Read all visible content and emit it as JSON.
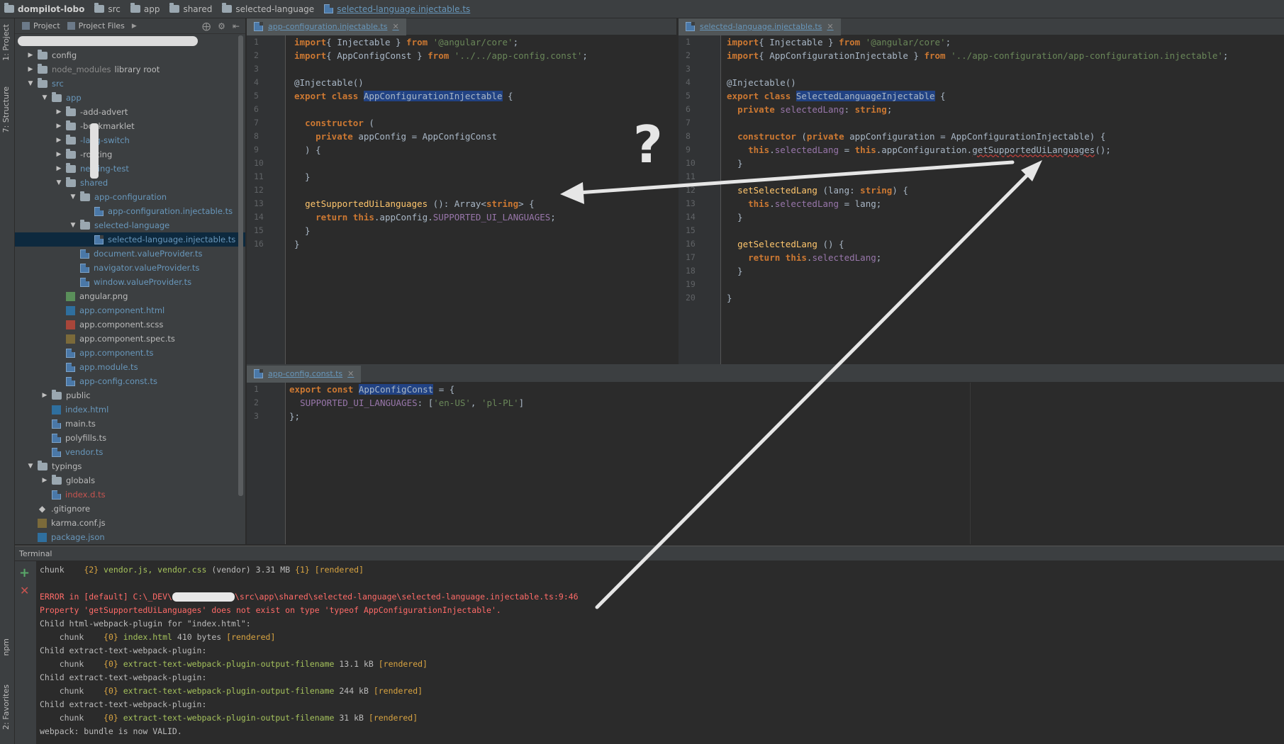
{
  "breadcrumb": [
    "dompilot-lobo",
    "src",
    "app",
    "shared",
    "selected-language",
    "selected-language.injectable.ts"
  ],
  "left_strip": {
    "project_tab": "1: Project",
    "structure_tab": "7: Structure",
    "npm_tab": "npm",
    "favorites_tab": "2: Favorites"
  },
  "project_panel": {
    "tabs": [
      "Project",
      "Project Files"
    ],
    "tree": [
      {
        "label": "config",
        "depth": 1,
        "kind": "folder",
        "arrow": "right"
      },
      {
        "label": "node_modules",
        "extra": "library root",
        "depth": 1,
        "kind": "folder",
        "arrow": "right",
        "style": "dim"
      },
      {
        "label": "src",
        "depth": 1,
        "kind": "folder",
        "arrow": "down",
        "style": "blue"
      },
      {
        "label": "app",
        "depth": 2,
        "kind": "folder",
        "arrow": "down",
        "style": "blue"
      },
      {
        "label": "-add-advert",
        "depth": 3,
        "kind": "folder",
        "arrow": "right"
      },
      {
        "label": "-bookmarklet",
        "depth": 3,
        "kind": "folder",
        "arrow": "right"
      },
      {
        "label": "-lang-switch",
        "depth": 3,
        "kind": "folder",
        "arrow": "right",
        "style": "blue"
      },
      {
        "label": "-routing",
        "depth": 3,
        "kind": "folder",
        "arrow": "right"
      },
      {
        "label": "nesting-test",
        "depth": 3,
        "kind": "folder",
        "arrow": "right",
        "style": "blue"
      },
      {
        "label": "shared",
        "depth": 3,
        "kind": "folder",
        "arrow": "down",
        "style": "blue"
      },
      {
        "label": "app-configuration",
        "depth": 4,
        "kind": "folder",
        "arrow": "down",
        "style": "blue"
      },
      {
        "label": "app-configuration.injectable.ts",
        "depth": 5,
        "kind": "ts",
        "style": "blue"
      },
      {
        "label": "selected-language",
        "depth": 4,
        "kind": "folder",
        "arrow": "down",
        "style": "blue"
      },
      {
        "label": "selected-language.injectable.ts",
        "depth": 5,
        "kind": "ts",
        "style": "blue",
        "selected": true
      },
      {
        "label": "document.valueProvider.ts",
        "depth": 4,
        "kind": "ts",
        "style": "blue"
      },
      {
        "label": "navigator.valueProvider.ts",
        "depth": 4,
        "kind": "ts",
        "style": "blue"
      },
      {
        "label": "window.valueProvider.ts",
        "depth": 4,
        "kind": "ts",
        "style": "blue"
      },
      {
        "label": "angular.png",
        "depth": 3,
        "kind": "img"
      },
      {
        "label": "app.component.html",
        "depth": 3,
        "kind": "html",
        "style": "blue"
      },
      {
        "label": "app.component.scss",
        "depth": 3,
        "kind": "scss"
      },
      {
        "label": "app.component.spec.ts",
        "depth": 3,
        "kind": "spec"
      },
      {
        "label": "app.component.ts",
        "depth": 3,
        "kind": "ts",
        "style": "blue"
      },
      {
        "label": "app.module.ts",
        "depth": 3,
        "kind": "ts",
        "style": "blue"
      },
      {
        "label": "app-config.const.ts",
        "depth": 3,
        "kind": "ts",
        "style": "blue"
      },
      {
        "label": "public",
        "depth": 2,
        "kind": "folder",
        "arrow": "right"
      },
      {
        "label": "index.html",
        "depth": 2,
        "kind": "html",
        "style": "blue"
      },
      {
        "label": "main.ts",
        "depth": 2,
        "kind": "ts"
      },
      {
        "label": "polyfills.ts",
        "depth": 2,
        "kind": "ts"
      },
      {
        "label": "vendor.ts",
        "depth": 2,
        "kind": "ts",
        "style": "blue"
      },
      {
        "label": "typings",
        "depth": 1,
        "kind": "folder",
        "arrow": "down"
      },
      {
        "label": "globals",
        "depth": 2,
        "kind": "folder",
        "arrow": "right"
      },
      {
        "label": "index.d.ts",
        "depth": 2,
        "kind": "ts",
        "style": "red"
      },
      {
        "label": ".gitignore",
        "depth": 1,
        "kind": "git"
      },
      {
        "label": "karma.conf.js",
        "depth": 1,
        "kind": "js"
      },
      {
        "label": "package.json",
        "depth": 1,
        "kind": "json",
        "style": "blue"
      }
    ]
  },
  "editor_left": {
    "tab": "app-configuration.injectable.ts",
    "line_numbers": [
      "1",
      "2",
      "3",
      "4",
      "5",
      "6",
      "7",
      "8",
      "9",
      "10",
      "11",
      "12",
      "13",
      "14",
      "15",
      "16"
    ],
    "lines": [
      [
        [
          "kw",
          "import"
        ],
        [
          "",
          "{ Injectable } "
        ],
        [
          "kw",
          "from"
        ],
        [
          "str",
          " '@angular/core'"
        ],
        [
          "",
          ";"
        ]
      ],
      [
        [
          "kw",
          "import"
        ],
        [
          "",
          "{ AppConfigConst } "
        ],
        [
          "kw",
          "from"
        ],
        [
          "str",
          " '../../app-config.const'"
        ],
        [
          "",
          ";"
        ]
      ],
      [],
      [
        [
          "",
          "@Injectable()"
        ]
      ],
      [
        [
          "kw",
          "export class "
        ],
        [
          "hl",
          "AppConfigurationInjectable"
        ],
        [
          "",
          " {"
        ]
      ],
      [],
      [
        [
          "",
          "  "
        ],
        [
          "kw",
          "constructor"
        ],
        [
          "",
          " ("
        ]
      ],
      [
        [
          "",
          "    "
        ],
        [
          "kw",
          "private "
        ],
        [
          "",
          "appConfig = AppConfigConst"
        ]
      ],
      [
        [
          "",
          "  ) {"
        ]
      ],
      [],
      [
        [
          "",
          "  }"
        ]
      ],
      [],
      [
        [
          "",
          "  "
        ],
        [
          "fn",
          "getSupportedUiLanguages"
        ],
        [
          "",
          " (): Array<"
        ],
        [
          "kw",
          "string"
        ],
        [
          "",
          "> {"
        ]
      ],
      [
        [
          "",
          "    "
        ],
        [
          "kw",
          "return this"
        ],
        [
          "",
          ".appConfig."
        ],
        [
          "fld",
          "SUPPORTED_UI_LANGUAGES"
        ],
        [
          "",
          ";"
        ]
      ],
      [
        [
          "",
          "  }"
        ]
      ],
      [
        [
          "",
          "}"
        ]
      ]
    ]
  },
  "editor_right": {
    "tab": "selected-language.injectable.ts",
    "line_numbers": [
      "1",
      "2",
      "3",
      "4",
      "5",
      "6",
      "7",
      "8",
      "9",
      "10",
      "11",
      "12",
      "13",
      "14",
      "15",
      "16",
      "17",
      "18",
      "19",
      "20"
    ],
    "lines": [
      [
        [
          "kw",
          "import"
        ],
        [
          "",
          "{ Injectable } "
        ],
        [
          "kw",
          "from"
        ],
        [
          "str",
          " '@angular/core'"
        ],
        [
          "",
          ";"
        ]
      ],
      [
        [
          "kw",
          "import"
        ],
        [
          "",
          "{ AppConfigurationInjectable } "
        ],
        [
          "kw",
          "from"
        ],
        [
          "str",
          " '../app-configuration/app-configuration.injectable'"
        ],
        [
          "",
          ";"
        ]
      ],
      [],
      [
        [
          "",
          "@Injectable()"
        ]
      ],
      [
        [
          "kw",
          "export class "
        ],
        [
          "hl",
          "SelectedLanguageInjectable"
        ],
        [
          "",
          " {"
        ]
      ],
      [
        [
          "",
          "  "
        ],
        [
          "kw",
          "private "
        ],
        [
          "fld",
          "selectedLang"
        ],
        [
          "",
          ": "
        ],
        [
          "kw",
          "string"
        ],
        [
          "",
          ";"
        ]
      ],
      [],
      [
        [
          "",
          "  "
        ],
        [
          "kw",
          "constructor"
        ],
        [
          "",
          " ("
        ],
        [
          "kw",
          "private "
        ],
        [
          "",
          "appConfiguration = AppConfigurationInjectable) {"
        ]
      ],
      [
        [
          "",
          "    "
        ],
        [
          "kw",
          "this"
        ],
        [
          "",
          "."
        ],
        [
          "fld",
          "selectedLang"
        ],
        [
          "",
          " = "
        ],
        [
          "kw",
          "this"
        ],
        [
          "",
          ".appConfiguration."
        ],
        [
          "wavy",
          "getSupportedUiLanguages"
        ],
        [
          "",
          "();"
        ]
      ],
      [
        [
          "",
          "  }"
        ]
      ],
      [],
      [
        [
          "",
          "  "
        ],
        [
          "fn",
          "setSelectedLang"
        ],
        [
          "",
          " (lang: "
        ],
        [
          "kw",
          "string"
        ],
        [
          "",
          ") {"
        ]
      ],
      [
        [
          "",
          "    "
        ],
        [
          "kw",
          "this"
        ],
        [
          "",
          "."
        ],
        [
          "fld",
          "selectedLang"
        ],
        [
          "",
          " = lang;"
        ]
      ],
      [
        [
          "",
          "  }"
        ]
      ],
      [],
      [
        [
          "",
          "  "
        ],
        [
          "fn",
          "getSelectedLang"
        ],
        [
          "",
          " () {"
        ]
      ],
      [
        [
          "",
          "    "
        ],
        [
          "kw",
          "return this"
        ],
        [
          "",
          "."
        ],
        [
          "fld",
          "selectedLang"
        ],
        [
          "",
          ";"
        ]
      ],
      [
        [
          "",
          "  }"
        ]
      ],
      [],
      [
        [
          "",
          "}"
        ]
      ]
    ]
  },
  "editor_bottom": {
    "tab": "app-config.const.ts",
    "line_numbers": [
      "1",
      "2",
      "3"
    ],
    "lines": [
      [
        [
          "kw",
          "export const "
        ],
        [
          "hl",
          "AppConfigConst"
        ],
        [
          "",
          " = {"
        ]
      ],
      [
        [
          "",
          "  "
        ],
        [
          "fld",
          "SUPPORTED_UI_LANGUAGES"
        ],
        [
          "",
          ": ["
        ],
        [
          "str",
          "'en-US'"
        ],
        [
          "",
          ", "
        ],
        [
          "str",
          "'pl-PL'"
        ],
        [
          "",
          "]"
        ]
      ],
      [
        [
          "",
          "};"
        ]
      ]
    ]
  },
  "annotation": {
    "question_mark": "?"
  },
  "terminal": {
    "title": "Terminal",
    "lines": [
      [
        [
          "",
          "chunk    "
        ],
        [
          "tyel",
          "{2}"
        ],
        [
          "tgreen",
          " vendor.js, vendor.css"
        ],
        [
          "",
          " (vendor) 3.31 MB "
        ],
        [
          "tyel",
          "{1}"
        ],
        [
          "tyel",
          " [rendered]"
        ]
      ],
      [],
      [
        [
          "tred",
          "ERROR in [default] C:\\_DEV\\"
        ],
        [
          "redact",
          ""
        ],
        [
          "tred",
          "\\src\\app\\shared\\selected-language\\selected-language.injectable.ts:9:46"
        ]
      ],
      [
        [
          "tred",
          "Property 'getSupportedUiLanguages' does not exist on type 'typeof AppConfigurationInjectable'."
        ]
      ],
      [
        [
          "",
          "Child html-webpack-plugin for \"index.html\":"
        ]
      ],
      [
        [
          "",
          "    chunk    "
        ],
        [
          "tyel",
          "{0}"
        ],
        [
          "tgreen",
          " index.html"
        ],
        [
          "",
          " 410 bytes "
        ],
        [
          "tyel",
          "[rendered]"
        ]
      ],
      [
        [
          "",
          "Child extract-text-webpack-plugin:"
        ]
      ],
      [
        [
          "",
          "    chunk    "
        ],
        [
          "tyel",
          "{0}"
        ],
        [
          "tgreen",
          " extract-text-webpack-plugin-output-filename"
        ],
        [
          "",
          " 13.1 kB "
        ],
        [
          "tyel",
          "[rendered]"
        ]
      ],
      [
        [
          "",
          "Child extract-text-webpack-plugin:"
        ]
      ],
      [
        [
          "",
          "    chunk    "
        ],
        [
          "tyel",
          "{0}"
        ],
        [
          "tgreen",
          " extract-text-webpack-plugin-output-filename"
        ],
        [
          "",
          " 244 kB "
        ],
        [
          "tyel",
          "[rendered]"
        ]
      ],
      [
        [
          "",
          "Child extract-text-webpack-plugin:"
        ]
      ],
      [
        [
          "",
          "    chunk    "
        ],
        [
          "tyel",
          "{0}"
        ],
        [
          "tgreen",
          " extract-text-webpack-plugin-output-filename"
        ],
        [
          "",
          " 31 kB "
        ],
        [
          "tyel",
          "[rendered]"
        ]
      ],
      [
        [
          "",
          "webpack: bundle is now VALID."
        ]
      ]
    ]
  }
}
